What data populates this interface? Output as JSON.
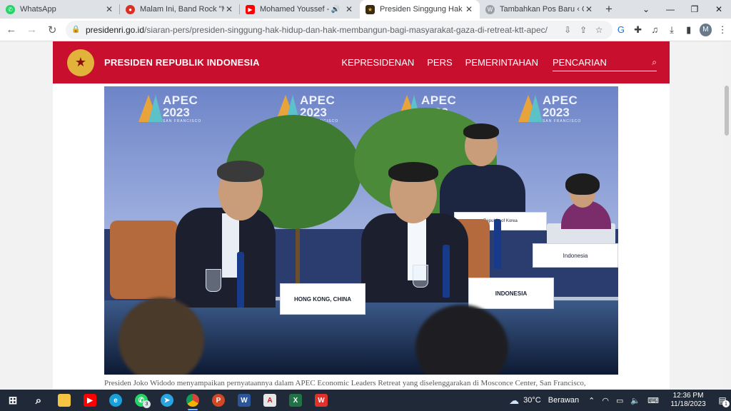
{
  "browser": {
    "tabs": [
      {
        "title": "WhatsApp",
        "favicon": "whatsapp-icon",
        "color": "#25d366"
      },
      {
        "title": "Malam Ini, Band Rock \"Metal",
        "favicon": "news-icon",
        "color": "#d93025"
      },
      {
        "title": "Mohamed Youssef - Bes",
        "favicon": "youtube-icon",
        "color": "#ff0000"
      },
      {
        "title": "Presiden Singgung Hak Hidu",
        "favicon": "garuda-icon",
        "color": "#c8a23c"
      },
      {
        "title": "Tambahkan Pos Baru ‹ Orine",
        "favicon": "wordpress-icon",
        "color": "#5f6368"
      }
    ],
    "url_host": "presidenri.go.id",
    "url_path": "/siaran-pers/presiden-singgung-hak-hidup-dan-hak-membangun-bagi-masyarakat-gaza-di-retreat-ktt-apec/",
    "profile_initial": "M"
  },
  "site": {
    "name": "PRESIDEN REPUBLIK INDONESIA",
    "nav": [
      "KEPRESIDENAN",
      "PERS",
      "PEMERINTAHAN"
    ],
    "search_label": "PENCARIAN"
  },
  "photo": {
    "banner_line1": "APEC",
    "banner_line2": "2023",
    "banner_line3": "SAN FRANCISCO",
    "placard_hk": "HONG KONG, CHINA",
    "placard_id": "INDONESIA",
    "placard_korea": "Republic of Korea",
    "placard_indonesia_rear": "Indonesia",
    "mini_apec": "APEC\n2023"
  },
  "caption": "Presiden Joko Widodo menyampaikan pernyataannya dalam APEC Economic Leaders Retreat yang diselenggarakan di Mosconce Center, San Francisco,",
  "taskbar": {
    "weather_temp": "30°C",
    "weather_cond": "Berawan",
    "time": "12:36 PM",
    "date": "11/18/2023",
    "whatsapp_badge": "3",
    "notification_count": "1"
  }
}
